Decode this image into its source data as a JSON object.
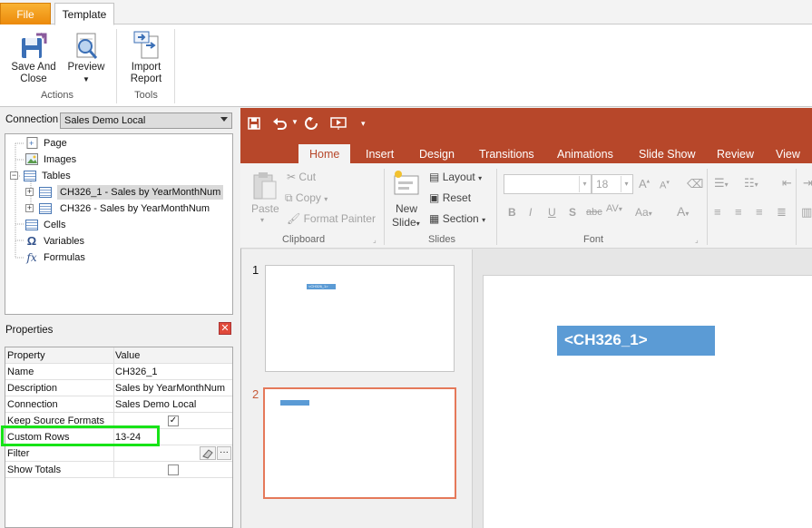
{
  "app": {
    "tabs": {
      "file": "File",
      "template": "Template"
    },
    "ribbon": {
      "save_close": [
        "Save And",
        "Close"
      ],
      "preview": "Preview",
      "import_report": [
        "Import",
        "Report"
      ],
      "group_actions": "Actions",
      "group_tools": "Tools"
    }
  },
  "connection": {
    "label": "Connection",
    "value": "Sales Demo Local"
  },
  "tree": {
    "page": "Page",
    "images": "Images",
    "tables": "Tables",
    "table1": "CH326_1 - Sales by YearMonthNum",
    "table2": "CH326 - Sales by YearMonthNum",
    "cells": "Cells",
    "variables": "Variables",
    "formulas": "Formulas"
  },
  "properties": {
    "title": "Properties",
    "col_property": "Property",
    "col_value": "Value",
    "rows": [
      {
        "name": "Name",
        "value": "CH326_1"
      },
      {
        "name": "Description",
        "value": "Sales by YearMonthNum"
      },
      {
        "name": "Connection",
        "value": "Sales Demo Local"
      },
      {
        "name": "Keep Source Formats",
        "value": ""
      },
      {
        "name": "Custom Rows",
        "value": "13-24"
      },
      {
        "name": "Filter",
        "value": ""
      },
      {
        "name": "Show Totals",
        "value": ""
      }
    ]
  },
  "ppt": {
    "tabs": [
      "Home",
      "Insert",
      "Design",
      "Transitions",
      "Animations",
      "Slide Show",
      "Review",
      "View"
    ],
    "clipboard": {
      "paste": "Paste",
      "cut": "Cut",
      "copy": "Copy",
      "format_painter": "Format Painter",
      "group": "Clipboard"
    },
    "slides": {
      "new_slide": [
        "New",
        "Slide"
      ],
      "layout": "Layout",
      "reset": "Reset",
      "section": "Section",
      "group": "Slides"
    },
    "font": {
      "size": "18",
      "group": "Font"
    },
    "thumb_nums": [
      "1",
      "2"
    ],
    "thumb1_tag": "<CH326_1>",
    "canvas_tag": "<CH326_1>"
  }
}
